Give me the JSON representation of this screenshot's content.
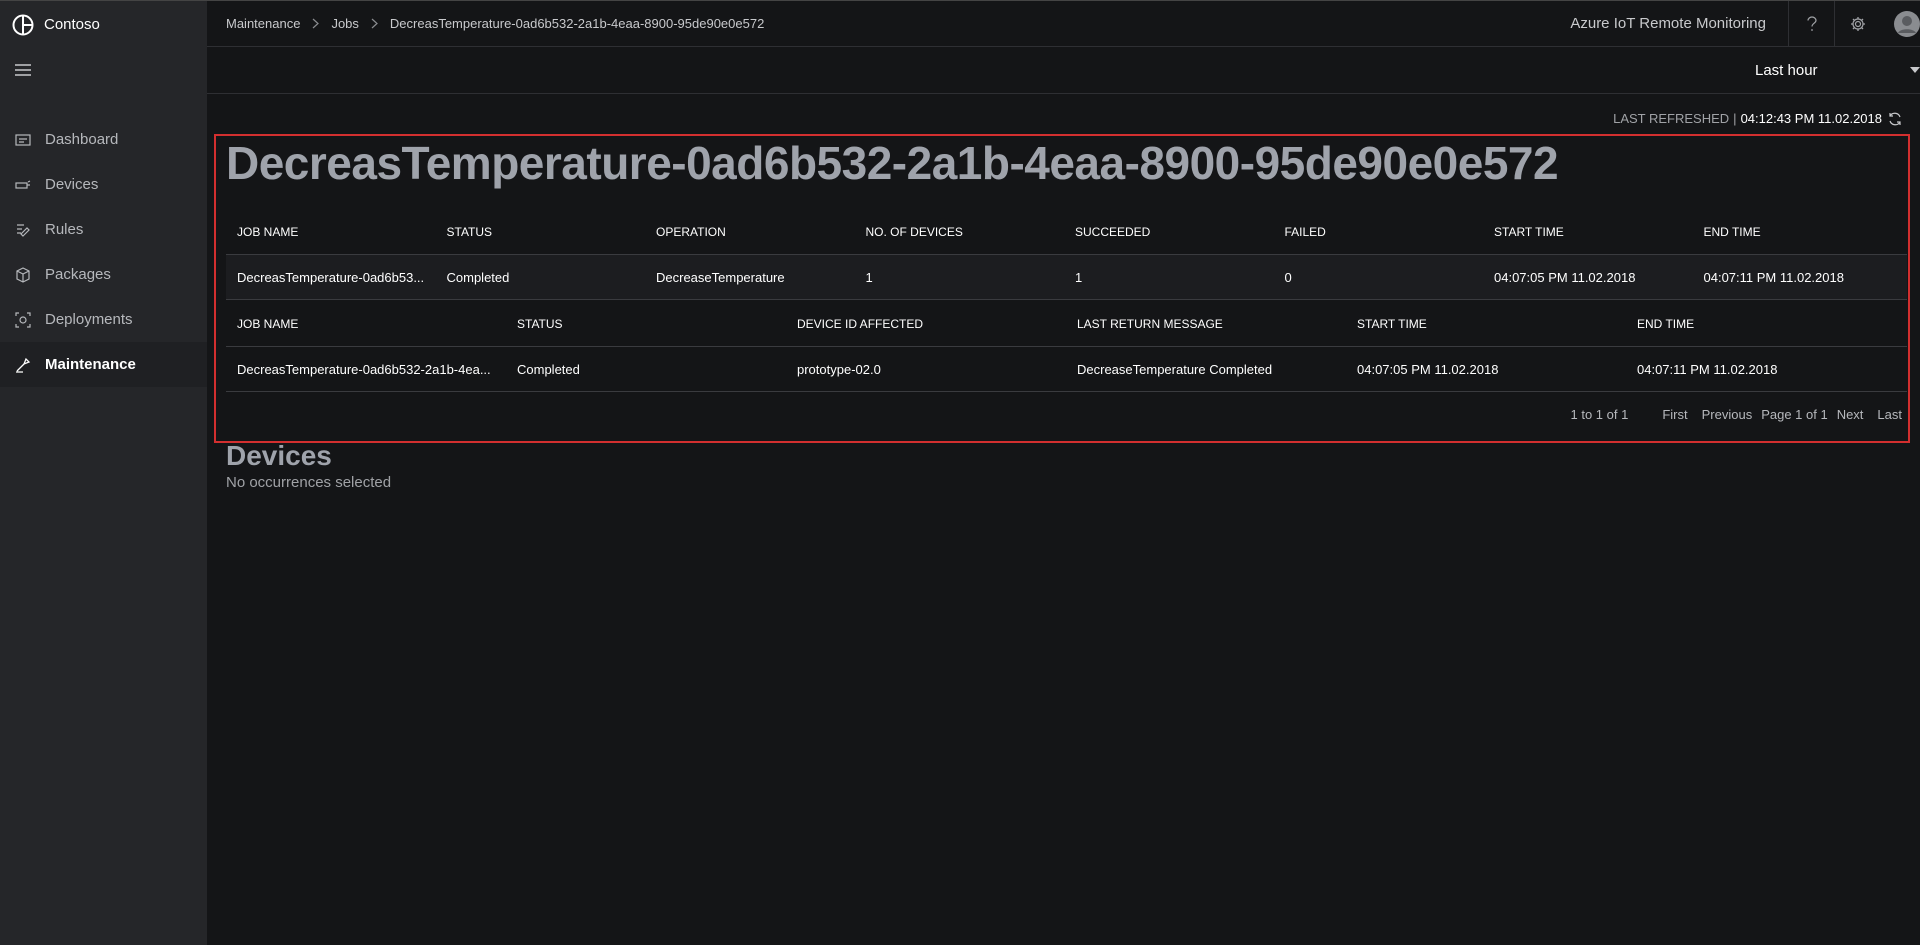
{
  "brand": {
    "name": "Contoso",
    "icon": "contoso-logo-icon"
  },
  "sidebar": {
    "items": [
      {
        "label": "Dashboard",
        "icon": "dashboard-icon"
      },
      {
        "label": "Devices",
        "icon": "devices-icon"
      },
      {
        "label": "Rules",
        "icon": "rules-icon"
      },
      {
        "label": "Packages",
        "icon": "packages-icon"
      },
      {
        "label": "Deployments",
        "icon": "deployments-icon"
      },
      {
        "label": "Maintenance",
        "icon": "maintenance-icon",
        "active": true
      }
    ]
  },
  "header": {
    "breadcrumb": [
      "Maintenance",
      "Jobs",
      "DecreasTemperature-0ad6b532-2a1b-4eaa-8900-95de90e0e572"
    ],
    "app_title": "Azure IoT Remote Monitoring"
  },
  "time_range": {
    "selected": "Last hour"
  },
  "refresh": {
    "label": "LAST REFRESHED",
    "separator": "|",
    "time": "04:12:43 PM 11.02.2018"
  },
  "job": {
    "title": "DecreasTemperature-0ad6b532-2a1b-4eaa-8900-95de90e0e572",
    "summary_table": {
      "columns": [
        "JOB NAME",
        "STATUS",
        "OPERATION",
        "NO. OF DEVICES",
        "SUCCEEDED",
        "FAILED",
        "START TIME",
        "END TIME"
      ],
      "rows": [
        [
          "DecreasTemperature-0ad6b53...",
          "Completed",
          "DecreaseTemperature",
          "1",
          "1",
          "0",
          "04:07:05 PM 11.02.2018",
          "04:07:11 PM 11.02.2018"
        ]
      ]
    },
    "device_table": {
      "columns": [
        "JOB NAME",
        "STATUS",
        "DEVICE ID AFFECTED",
        "LAST RETURN MESSAGE",
        "START TIME",
        "END TIME"
      ],
      "rows": [
        [
          "DecreasTemperature-0ad6b532-2a1b-4ea...",
          "Completed",
          "prototype-02.0",
          "DecreaseTemperature Completed",
          "04:07:05 PM 11.02.2018",
          "04:07:11 PM 11.02.2018"
        ]
      ]
    },
    "pager": {
      "range": "1 to 1 of 1",
      "first": "First",
      "previous": "Previous",
      "page": "Page 1 of 1",
      "next": "Next",
      "last": "Last"
    }
  },
  "devices": {
    "title": "Devices",
    "empty_message": "No occurrences selected"
  },
  "colors": {
    "highlight_border": "#d32f2f",
    "sidebar_bg": "#252629",
    "page_bg": "#141517"
  }
}
